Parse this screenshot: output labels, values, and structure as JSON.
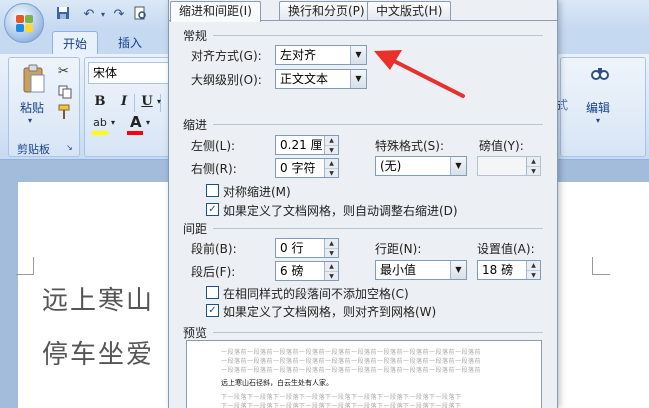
{
  "ribbon": {
    "tabs": [
      {
        "label": "开始"
      },
      {
        "label": "插入"
      }
    ],
    "clipboard": {
      "paste_label": "粘贴",
      "group_label": "剪贴板",
      "launcher": "↘"
    },
    "font": {
      "name_value": "宋体",
      "bold": "B",
      "italic": "I",
      "underline": "U",
      "highlight_icon": "ab",
      "font_color": "A"
    },
    "styles_partial_label": "式",
    "editing": {
      "label": "编辑"
    },
    "icons": [
      "office-button-icon",
      "save-icon",
      "undo-icon",
      "redo-icon",
      "print-preview-icon",
      "paste-icon",
      "cut-icon",
      "copy-icon",
      "format-painter-icon",
      "find-icon"
    ]
  },
  "document": {
    "line1": "远上寒山",
    "line2": "停车坐爱"
  },
  "dialog": {
    "tabs": [
      {
        "label": "缩进和间距(I)"
      },
      {
        "label": "换行和分页(P)"
      },
      {
        "label": "中文版式(H)"
      }
    ],
    "general": {
      "section": "常规",
      "alignment_label": "对齐方式(G):",
      "alignment_value": "左对齐",
      "outline_label": "大纲级别(O):",
      "outline_value": "正文文本"
    },
    "indent": {
      "section": "缩进",
      "left_label": "左侧(L):",
      "left_value": "0.21 厘",
      "right_label": "右侧(R):",
      "right_value": "0 字符",
      "special_label": "特殊格式(S):",
      "special_value": "(无)",
      "by_label": "磅值(Y):",
      "by_value": "",
      "mirror_label": "对称缩进(M)",
      "mirror_checked": false,
      "auto_adjust_label": "如果定义了文档网格，则自动调整右缩进(D)",
      "auto_adjust_checked": true
    },
    "spacing": {
      "section": "间距",
      "before_label": "段前(B):",
      "before_value": "0 行",
      "after_label": "段后(F):",
      "after_value": "6 磅",
      "line_label": "行距(N):",
      "line_value": "最小值",
      "at_label": "设置值(A):",
      "at_value": "18 磅",
      "no_space_label": "在相同样式的段落间不添加空格(C)",
      "no_space_checked": false,
      "snap_grid_label": "如果定义了文档网格，则对齐到网格(W)",
      "snap_grid_checked": true
    },
    "preview": {
      "section": "预览",
      "prev_text": "一段落前一段落前一段落前一段落前一段落前一段落前一段落前一段落前一段落前一段落前",
      "sample_text": "远上寒山石径斜，白云生处有人家。",
      "next_text": "下一段落下一段落下一段落下一段落下一段落下一段落下一段落下一段落下一段落下"
    }
  },
  "colors": {
    "annotation_arrow": "#e8312a",
    "ribbon_text": "#15428b",
    "dialog_bg": "#eceff4"
  }
}
